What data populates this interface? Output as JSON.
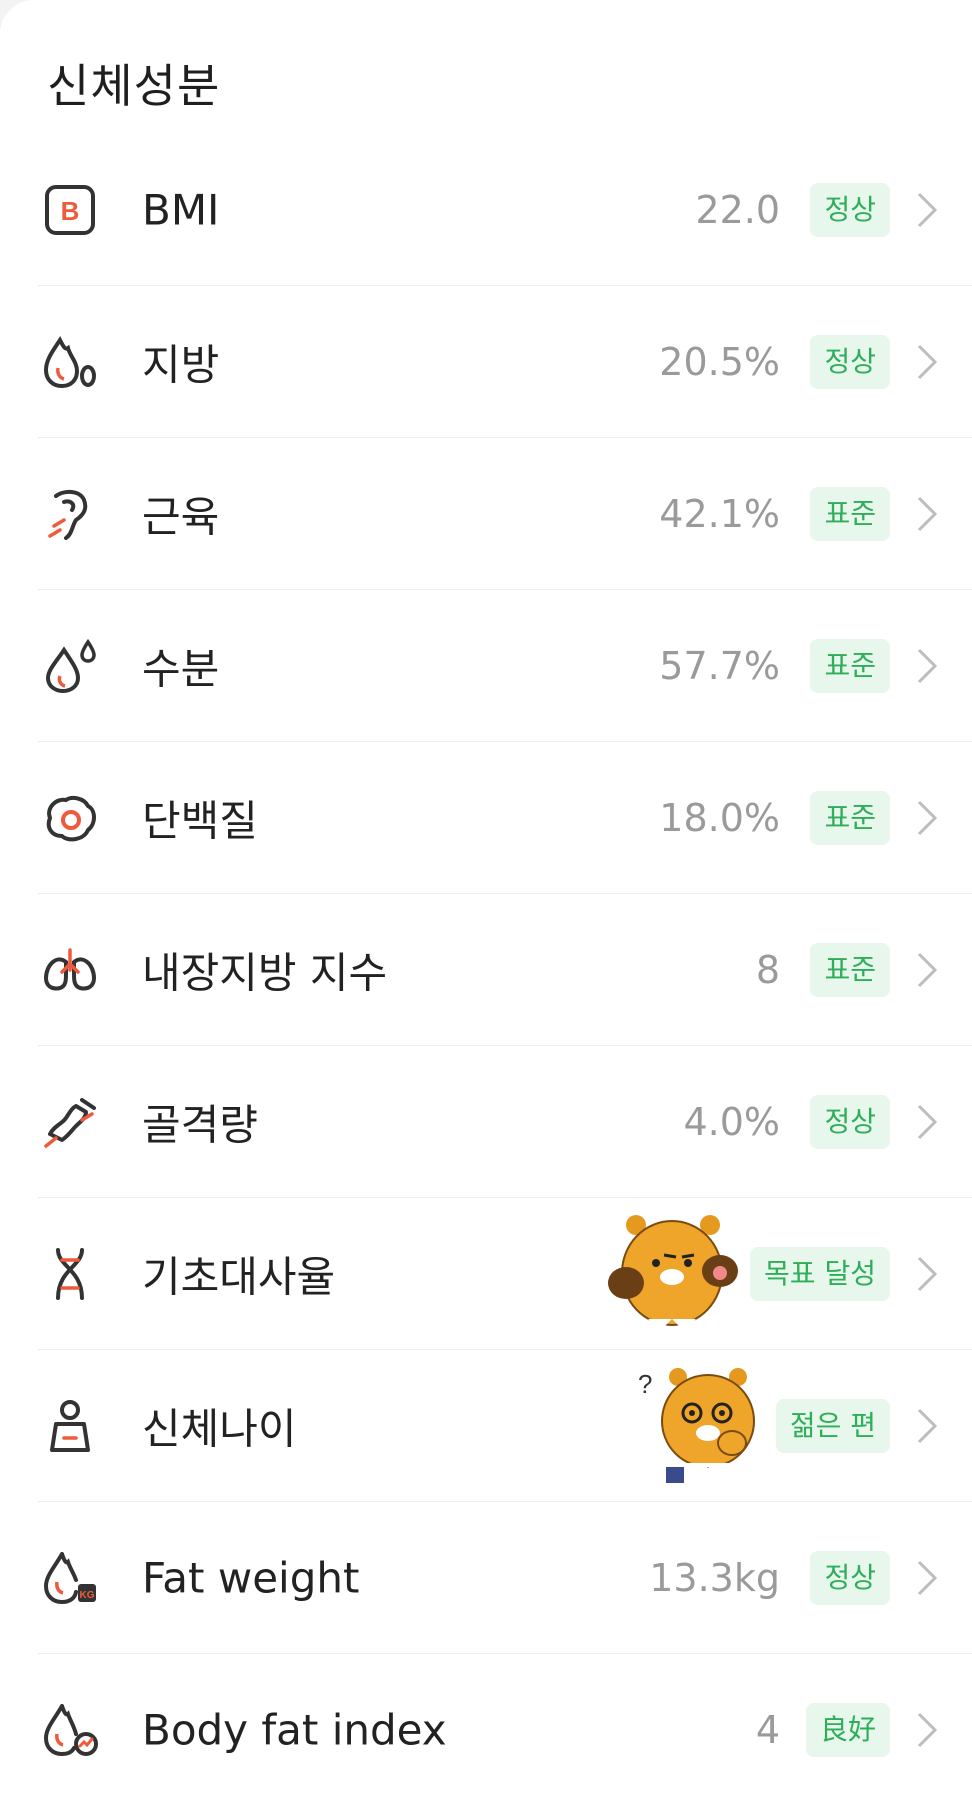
{
  "card": {
    "title": "신체성분"
  },
  "rows": [
    {
      "label": "BMI",
      "value": "22.0",
      "badge": "정상",
      "icon": "bmi-icon"
    },
    {
      "label": "지방",
      "value": "20.5%",
      "badge": "정상",
      "icon": "fat-drop-icon"
    },
    {
      "label": "근육",
      "value": "42.1%",
      "badge": "표준",
      "icon": "muscle-arm-icon"
    },
    {
      "label": "수분",
      "value": "57.7%",
      "badge": "표준",
      "icon": "water-drop-icon"
    },
    {
      "label": "단백질",
      "value": "18.0%",
      "badge": "표준",
      "icon": "protein-icon"
    },
    {
      "label": "내장지방 지수",
      "value": "8",
      "badge": "표준",
      "icon": "visceral-fat-icon"
    },
    {
      "label": "골격량",
      "value": "4.0%",
      "badge": "정상",
      "icon": "bone-icon"
    },
    {
      "label": "기초대사율",
      "value": "",
      "badge": "목표 달성",
      "icon": "dna-icon",
      "sticker": "lion-mascot-boxing"
    },
    {
      "label": "신체나이",
      "value": "",
      "badge": "젊은 편",
      "icon": "body-age-icon",
      "sticker": "lion-mascot-thinking"
    },
    {
      "label": "Fat weight",
      "value": "13.3kg",
      "badge": "정상",
      "icon": "fat-weight-icon"
    },
    {
      "label": "Body fat index",
      "value": "4",
      "badge": "良好",
      "icon": "body-fat-index-icon"
    }
  ],
  "colors": {
    "badge_bg": "#e7f7ec",
    "badge_text": "#2fae59",
    "icon_accent": "#f05a3c"
  }
}
